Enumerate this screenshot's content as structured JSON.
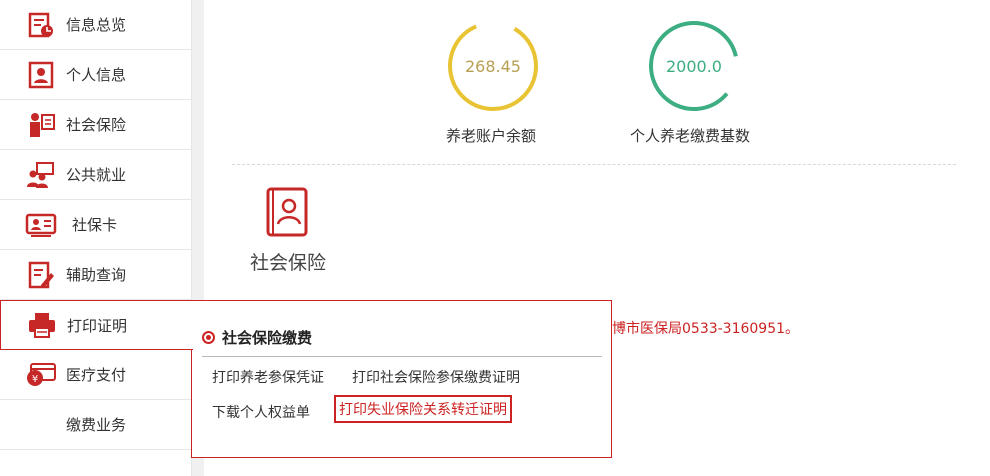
{
  "sidebar": {
    "items": [
      {
        "label": "信息总览",
        "icon": "overview-icon"
      },
      {
        "label": "个人信息",
        "icon": "personal-info-icon"
      },
      {
        "label": "社会保险",
        "icon": "social-insurance-icon"
      },
      {
        "label": "公共就业",
        "icon": "employment-icon"
      },
      {
        "label": "社保卡",
        "icon": "id-card-icon"
      },
      {
        "label": "辅助查询",
        "icon": "query-icon"
      },
      {
        "label": "打印证明",
        "icon": "printer-icon"
      },
      {
        "label": "医疗支付",
        "icon": "payment-card-icon"
      },
      {
        "label": "缴费业务",
        "icon": ""
      }
    ]
  },
  "stats": [
    {
      "value": "268.45",
      "label": "养老账户余额",
      "color": "#e8c434"
    },
    {
      "value": "2000.0",
      "label": "个人养老缴费基数",
      "color": "#3dae82"
    }
  ],
  "module": {
    "title": "社会保险",
    "icon": "contact-card-icon"
  },
  "notice": "博市医保局0533-3160951。",
  "popup": {
    "section_title": "社会保险缴费",
    "links": {
      "pension_voucher": "打印养老参保凭证",
      "insurance_payment_cert": "打印社会保险参保缴费证明",
      "download_rights": "下载个人权益单",
      "unemployment_transfer": "打印失业保险关系转迁证明"
    }
  },
  "colors": {
    "accent": "#cc2222"
  }
}
